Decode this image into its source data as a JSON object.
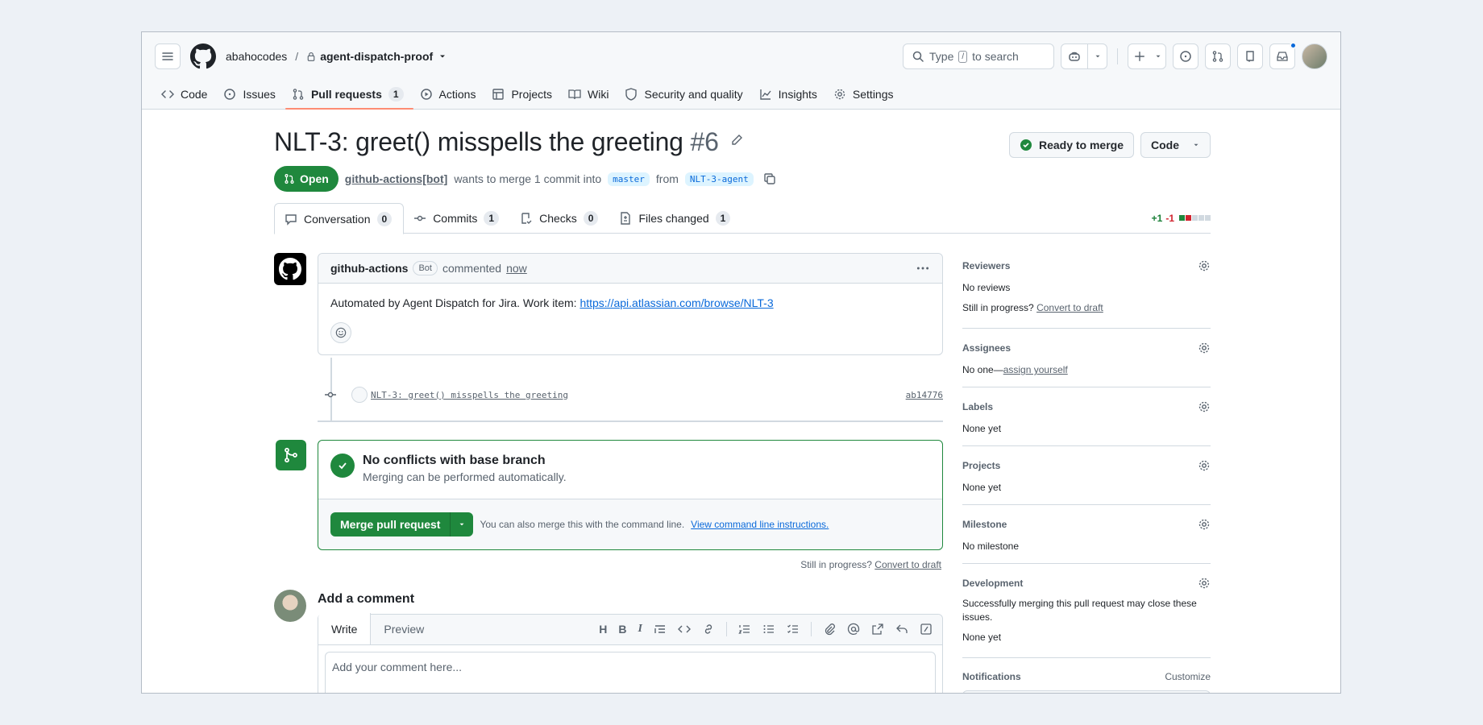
{
  "header": {
    "owner": "abahocodes",
    "separator": "/",
    "repo": "agent-dispatch-proof",
    "search_prefix": "Type",
    "search_key": "/",
    "search_suffix": "to search"
  },
  "repo_nav": [
    {
      "label": "Code",
      "icon": "code-icon"
    },
    {
      "label": "Issues",
      "icon": "issue-icon"
    },
    {
      "label": "Pull requests",
      "icon": "pull-request-icon",
      "count": "1",
      "active": true
    },
    {
      "label": "Actions",
      "icon": "play-icon"
    },
    {
      "label": "Projects",
      "icon": "table-icon"
    },
    {
      "label": "Wiki",
      "icon": "book-icon"
    },
    {
      "label": "Security and quality",
      "icon": "shield-icon"
    },
    {
      "label": "Insights",
      "icon": "graph-icon"
    },
    {
      "label": "Settings",
      "icon": "gear-icon"
    }
  ],
  "pr": {
    "title": "NLT-3: greet() misspells the greeting",
    "number": "#6",
    "state": "Open",
    "author": "github-actions[bot]",
    "merge_text": "wants to merge 1 commit into",
    "base": "master",
    "from_text": "from",
    "head": "NLT-3-agent",
    "ready_label": "Ready to merge",
    "code_label": "Code"
  },
  "pr_tabs": [
    {
      "label": "Conversation",
      "count": "0",
      "icon": "comment-icon",
      "active": true
    },
    {
      "label": "Commits",
      "count": "1",
      "icon": "commit-icon"
    },
    {
      "label": "Checks",
      "count": "0",
      "icon": "checklist-icon"
    },
    {
      "label": "Files changed",
      "count": "1",
      "icon": "file-diff-icon"
    }
  ],
  "diffstat": {
    "additions": "+1",
    "deletions": "-1"
  },
  "comment": {
    "author": "github-actions",
    "badge": "Bot",
    "action": "commented",
    "time": "now",
    "body": "Automated by Agent Dispatch for Jira. Work item:",
    "link": "https://api.atlassian.com/browse/NLT-3"
  },
  "commit": {
    "message": "NLT-3: greet() misspells the greeting",
    "sha": "ab14776"
  },
  "merge": {
    "title": "No conflicts with base branch",
    "subtitle": "Merging can be performed automatically.",
    "button": "Merge pull request",
    "hint": "You can also merge this with the command line.",
    "hint_link": "View command line instructions.",
    "still_label": "Still in progress?",
    "draft_link": "Convert to draft"
  },
  "add_comment": {
    "heading": "Add a comment",
    "write_tab": "Write",
    "preview_tab": "Preview",
    "placeholder": "Add your comment here..."
  },
  "sidebar": {
    "reviewers": {
      "title": "Reviewers",
      "value": "No reviews",
      "still": "Still in progress?",
      "draft": "Convert to draft"
    },
    "assignees": {
      "title": "Assignees",
      "prefix": "No one—",
      "link": "assign yourself"
    },
    "labels": {
      "title": "Labels",
      "value": "None yet"
    },
    "projects": {
      "title": "Projects",
      "value": "None yet"
    },
    "milestone": {
      "title": "Milestone",
      "value": "No milestone"
    },
    "development": {
      "title": "Development",
      "desc": "Successfully merging this pull request may close these issues.",
      "value": "None yet"
    },
    "notifications": {
      "title": "Notifications",
      "customize": "Customize"
    }
  },
  "colors": {
    "accent": "#1f883d",
    "link": "#0969da",
    "active_tab": "#fd8c73"
  }
}
